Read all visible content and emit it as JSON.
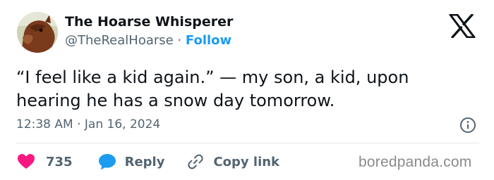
{
  "author": {
    "display_name": "The Hoarse Whisperer",
    "handle": "@TheRealHoarse",
    "separator": "·",
    "follow_label": "Follow",
    "avatar_icon": "horse-avatar"
  },
  "platform_icon": "x-logo-icon",
  "tweet": {
    "text": "“I feel like a kid again.” — my son, a kid, upon hearing he has a snow day tomorrow.",
    "timestamp": "12:38 AM · Jan 16, 2024"
  },
  "actions": {
    "like_count": "735",
    "reply_label": "Reply",
    "copy_link_label": "Copy link"
  },
  "watermark": "boredpanda.com",
  "colors": {
    "accent": "#1d9bf0",
    "like": "#f91880",
    "text": "#0f1419",
    "secondary": "#536471"
  }
}
